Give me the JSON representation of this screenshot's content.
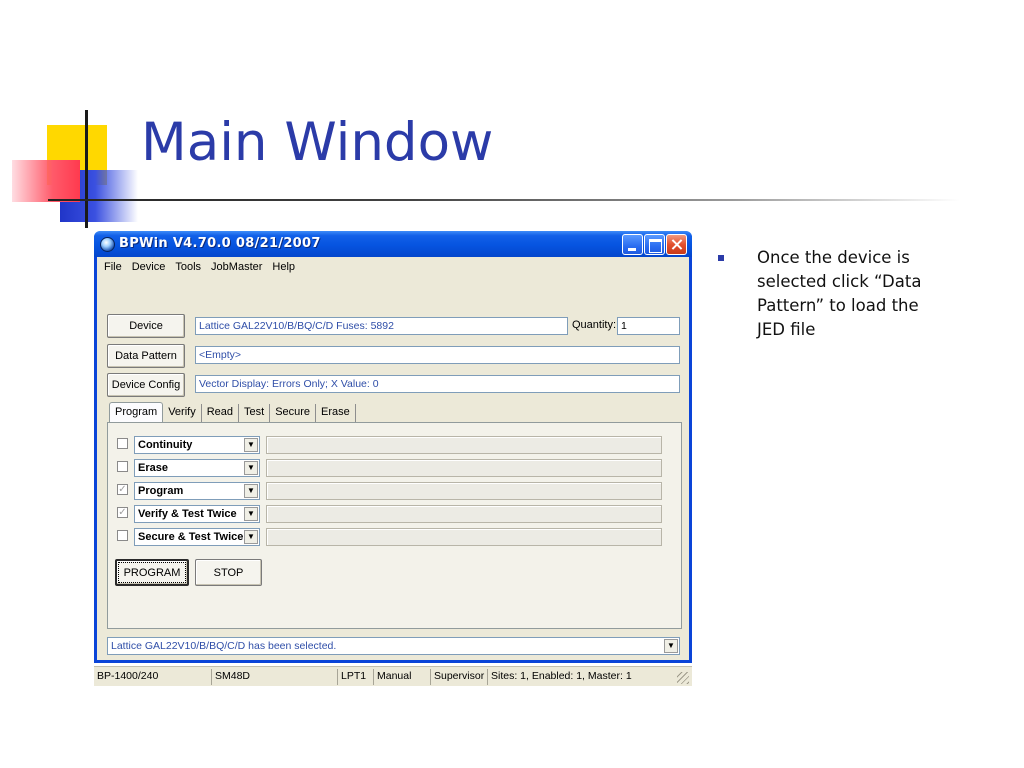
{
  "slide": {
    "title": "Main Window",
    "bullet": "Once the device is selected click “Data Pattern” to load the JED file"
  },
  "window": {
    "title": "BPWin  V4.70.0  08/21/2007",
    "menu": [
      "File",
      "Device",
      "Tools",
      "JobMaster",
      "Help"
    ],
    "device_button": "Device",
    "device_value": "Lattice GAL22V10/B/BQ/C/D    Fuses: 5892",
    "quantity_label": "Quantity:",
    "quantity_value": "1",
    "data_pattern_button": "Data Pattern",
    "data_pattern_value": "<Empty>",
    "device_config_button": "Device Config",
    "device_config_value": "Vector Display:  Errors Only;  X Value:  0",
    "tabs": [
      "Program",
      "Verify",
      "Read",
      "Test",
      "Secure",
      "Erase"
    ],
    "active_tab": "Program",
    "operations": [
      {
        "label": "Continuity",
        "checked": false
      },
      {
        "label": "Erase",
        "checked": false
      },
      {
        "label": "Program",
        "checked": true
      },
      {
        "label": "Verify & Test Twice",
        "checked": true
      },
      {
        "label": "Secure & Test Twice",
        "checked": false
      }
    ],
    "program_button": "PROGRAM",
    "stop_button": "STOP",
    "message": "Lattice GAL22V10/B/BQ/C/D has been selected.",
    "status": {
      "model": "BP-1400/240",
      "socket": "SM48D",
      "port": "LPT1",
      "mode": "Manual",
      "user": "Supervisor",
      "sites": "Sites: 1, Enabled: 1, Master: 1"
    }
  },
  "colors": {
    "title": "#2b3ba8",
    "titlebar": "#0654e0",
    "window_bg": "#ece9d8",
    "info_text": "#2f4ea8"
  }
}
